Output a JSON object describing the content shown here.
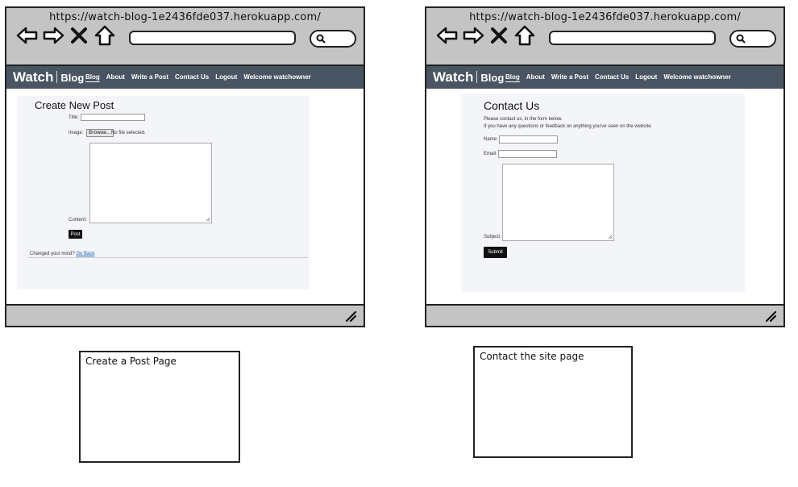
{
  "left_window": {
    "url": "https://watch-blog-1e2436fde037.herokuapp.com/",
    "brand_watch": "Watch",
    "brand_blog": "Blog",
    "nav": [
      "Blog",
      "About",
      "Write a Post",
      "Contact Us",
      "Logout",
      "Welcome watchowner"
    ],
    "page_title": "Create New Post",
    "title_label": "Title:",
    "image_label": "Image:",
    "browse_label": "Browse...",
    "no_file": "No file selected.",
    "content_label": "Content:",
    "post_button": "Post",
    "changed_mind": "Changed your mind?",
    "go_back": "Go Back"
  },
  "right_window": {
    "url": "https://watch-blog-1e2436fde037.herokuapp.com/",
    "brand_watch": "Watch",
    "brand_blog": "Blog",
    "nav": [
      "Blog",
      "About",
      "Write a Post",
      "Contact Us",
      "Logout",
      "Welcome watchowner"
    ],
    "page_title": "Contact Us",
    "intro_1": "Please contact us, in the form below.",
    "intro_2": "If you have any questions or feedback on anything you've seen on the website.",
    "name_label": "Name:",
    "email_label": "Email:",
    "subject_label": "Subject:",
    "submit_button": "Submit"
  },
  "captions": {
    "left": "Create a Post Page",
    "right": "Contact the site page"
  },
  "icons": [
    "back-arrow-icon",
    "forward-arrow-icon",
    "close-icon",
    "home-icon",
    "search-icon",
    "resize-grip-icon"
  ],
  "colors": {
    "chrome": "#c4c4c4",
    "navbar": "#4a5563",
    "panel": "#f4f5f8",
    "button": "#111111"
  }
}
